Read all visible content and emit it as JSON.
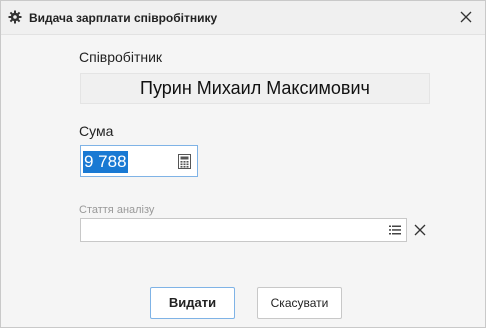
{
  "window": {
    "title": "Видача зарплати співробітнику",
    "icons": {
      "title": "gear-icon",
      "close": "close-icon"
    }
  },
  "employee": {
    "label": "Співробітник",
    "value": "Пурин Михаил Максимович"
  },
  "amount": {
    "label": "Сума",
    "value": "9 788",
    "icon": "calculator-icon"
  },
  "analysis": {
    "label": "Стаття аналізу",
    "value": "",
    "icons": {
      "list": "list-icon",
      "clear": "clear-icon"
    }
  },
  "buttons": {
    "issue": "Видати",
    "cancel": "Скасувати"
  },
  "colors": {
    "selection": "#1979d3",
    "focus_border": "#7fb3e6",
    "background": "#f5f5f5"
  }
}
